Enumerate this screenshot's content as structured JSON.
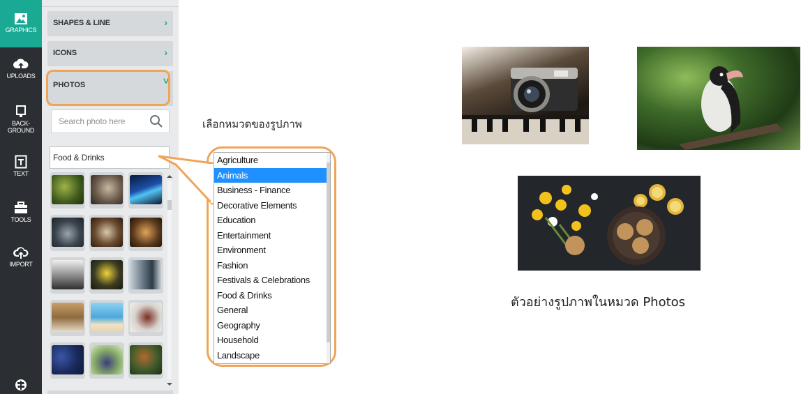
{
  "sidebar": {
    "tools": [
      {
        "label": "GRAPHICS",
        "icon": "image-icon"
      },
      {
        "label": "UPLOADS",
        "icon": "cloud-upload-icon"
      },
      {
        "label1": "BACK-",
        "label2": "GROUND",
        "icon": "background-icon"
      },
      {
        "label": "TEXT",
        "icon": "text-icon"
      },
      {
        "label": "TOOLS",
        "icon": "toolbox-icon"
      },
      {
        "label": "IMPORT",
        "icon": "import-icon"
      }
    ],
    "bottom_icon": "signpost-icon"
  },
  "panel": {
    "accordion": [
      {
        "label": "SHAPES & LINE",
        "chevron": "›"
      },
      {
        "label": "ICONS",
        "chevron": "›"
      },
      {
        "label": "PHOTOS",
        "chevron": "˅"
      }
    ],
    "search": {
      "placeholder": "Search photo here",
      "icon": "search-icon"
    },
    "category_select": {
      "value": "Food & Drinks"
    },
    "thumbnails_count": 15
  },
  "annotation": {
    "choose_category": "เลือกหมวดของรูปภาพ",
    "example_caption": "ตัวอย่างรูปภาพในหมวด Photos"
  },
  "category_list": {
    "selected": "Animals",
    "items": [
      "Agriculture",
      "Animals",
      "Business - Finance",
      "Decorative Elements",
      "Education",
      "Entertainment",
      "Environment",
      "Fashion",
      "Festivals & Celebrations",
      "Food & Drinks",
      "General",
      "Geography",
      "Household",
      "Landscape"
    ]
  },
  "colors": {
    "accent": "#1aaa94",
    "highlight": "#f0a458",
    "toolbar": "#2b2f33",
    "selection": "#1e90ff"
  }
}
